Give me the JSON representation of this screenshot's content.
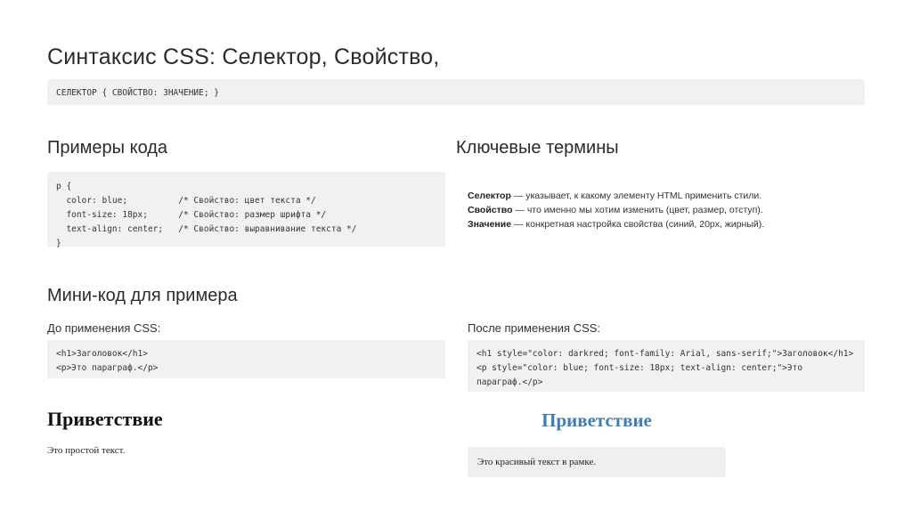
{
  "title": "Синтаксис CSS: Селектор, Свойство,",
  "syntax": "СЕЛЕКТОР { СВОЙСТВО: ЗНАЧЕНИЕ; }",
  "examples": {
    "heading": "Примеры кода",
    "lines": [
      "p {",
      "  color: blue;          /* Свойство: цвет текста */",
      "  font-size: 18px;      /* Свойство: размер шрифта */",
      "  text-align: center;   /* Свойство: выравнивание текста */",
      "}"
    ]
  },
  "terms": {
    "heading": "Ключевые термины",
    "items": [
      {
        "term": "Селектор",
        "desc": " — указывает, к какому элементу HTML применить стили."
      },
      {
        "term": "Свойство",
        "desc": " — что именно мы хотим изменить (цвет, размер, отступ)."
      },
      {
        "term": "Значение",
        "desc": " — конкретная настройка свойства (синий, 20px, жирный)."
      }
    ]
  },
  "mini": {
    "heading": "Мини-код для примера",
    "before": {
      "label": "До применения CSS:",
      "lines": [
        "<h1>Заголовок</h1>",
        "<p>Это параграф.</p>"
      ],
      "demo_title": "Приветствие",
      "demo_text": "Это простой текст."
    },
    "after": {
      "label": "После применения CSS:",
      "lines": [
        "<h1 style=\"color: darkred; font-family: Arial, sans-serif;\">Заголовок</h1>",
        "<p style=\"color: blue; font-size: 18px; text-align: center;\">Это",
        "параграф.</p>"
      ],
      "demo_title": "Приветствие",
      "demo_text": "Это красивый текст в рамке."
    }
  },
  "colors": {
    "code_bg": "#f1f1f1",
    "styled_title": "#3d7fb5",
    "styled_box": "#efefef"
  }
}
